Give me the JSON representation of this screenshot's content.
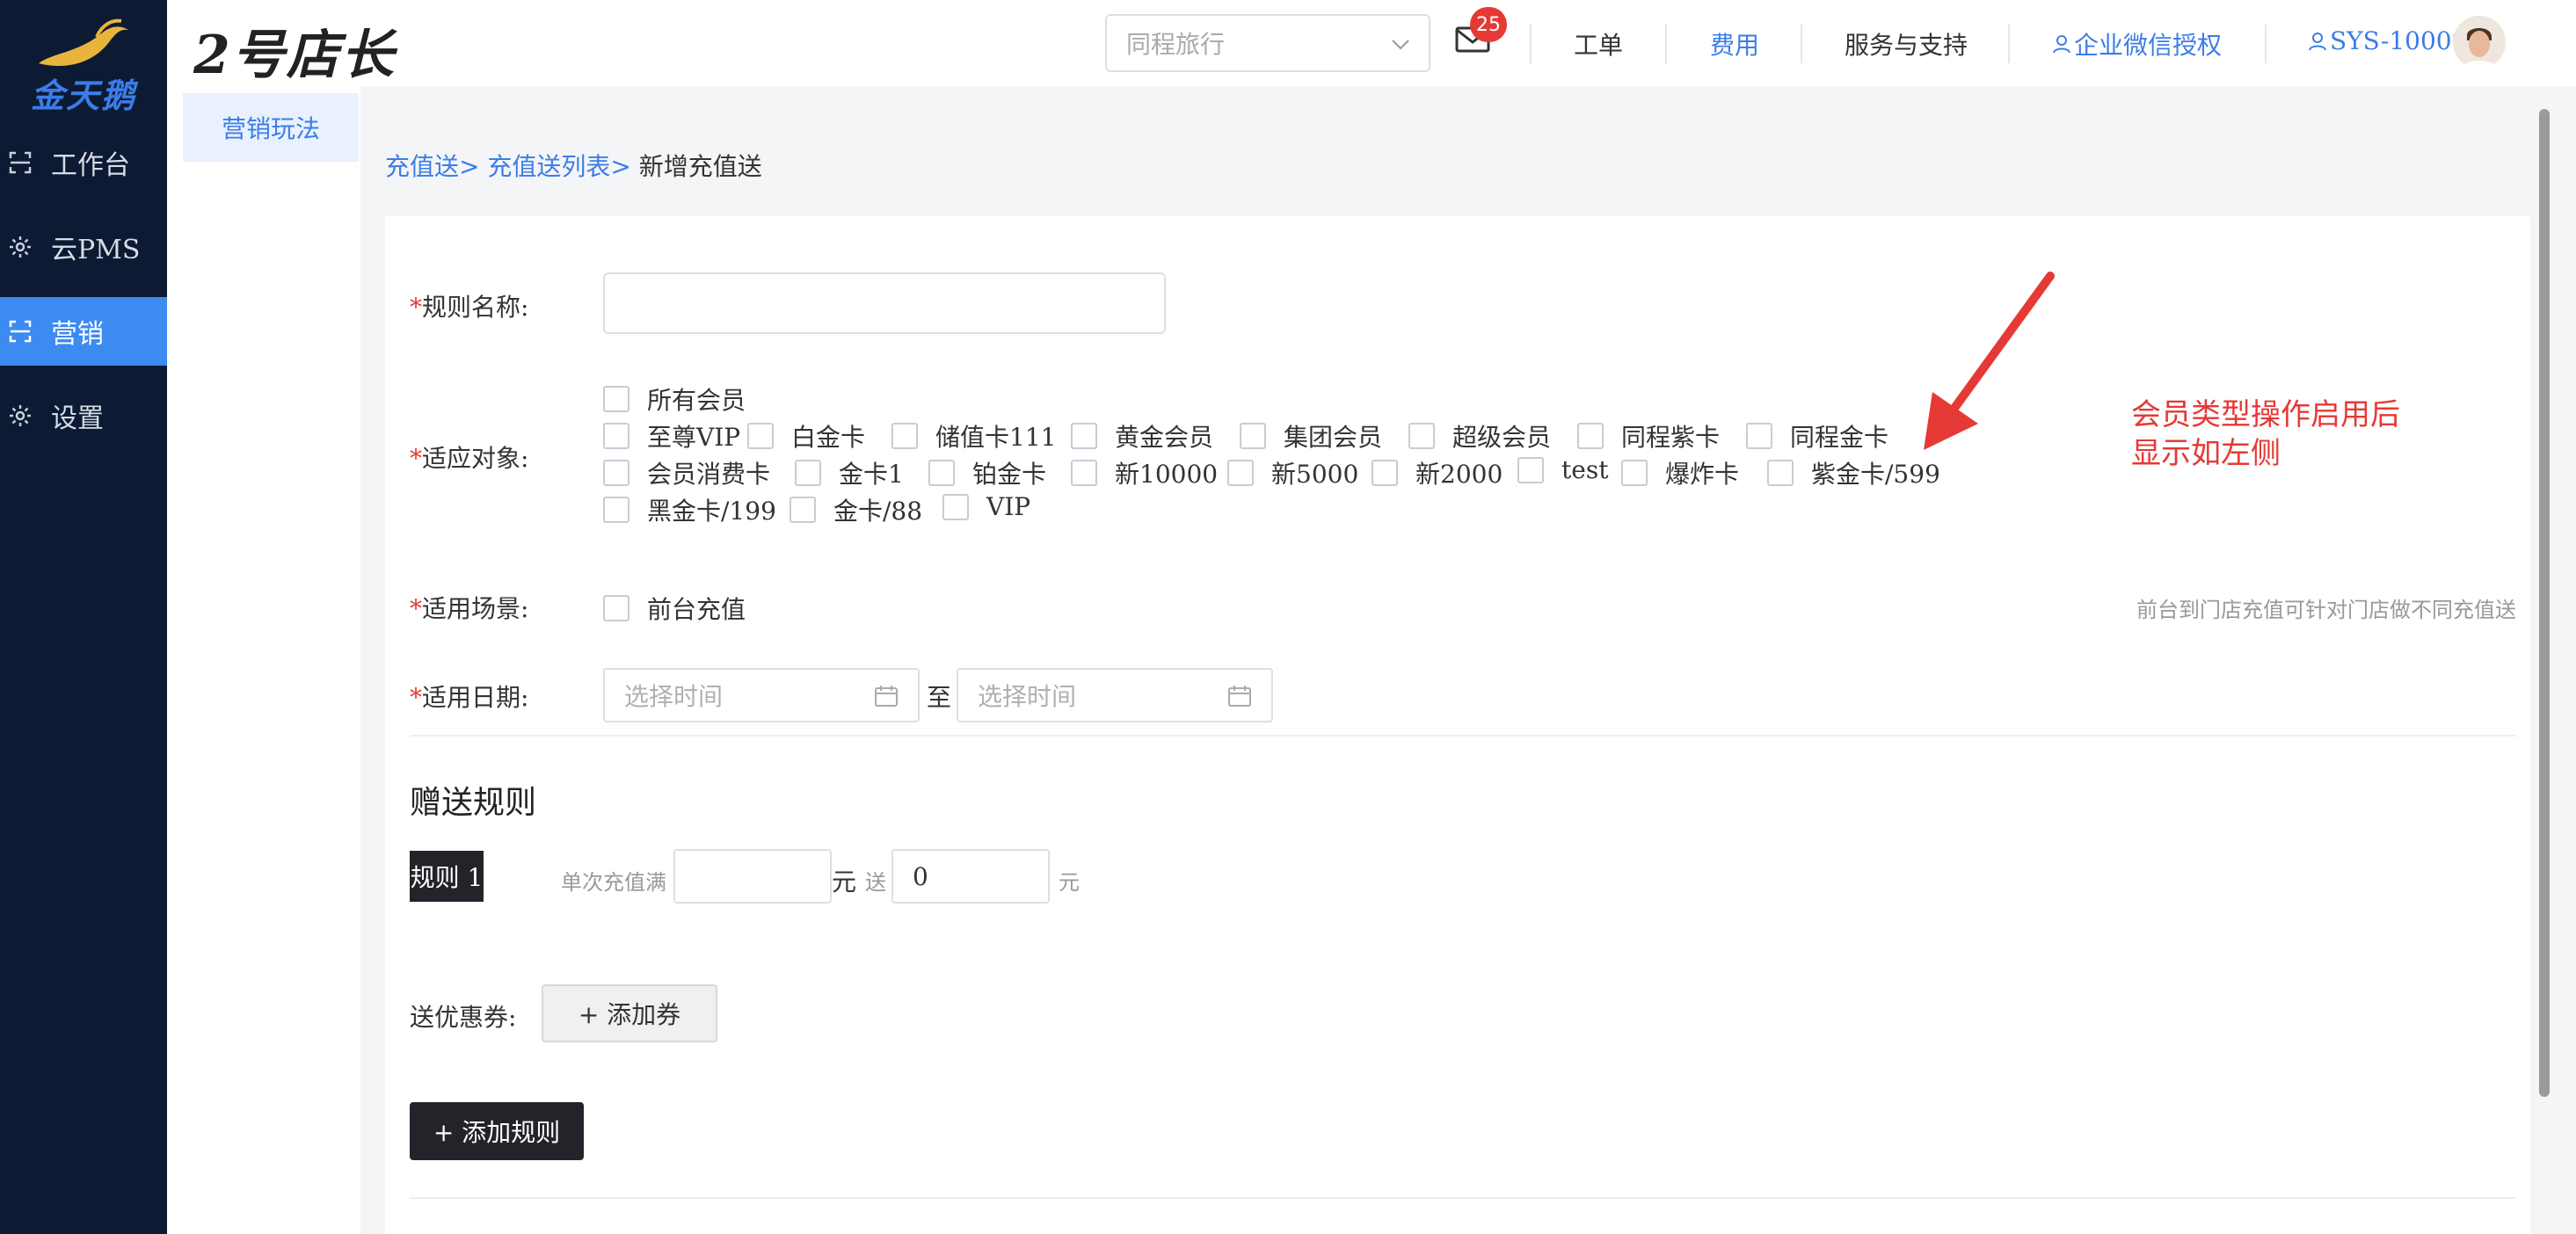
{
  "brand": {
    "name": "金天鹅"
  },
  "app_title": "2号店长",
  "nav": {
    "items": [
      {
        "label": "工作台",
        "icon": "scan-icon",
        "active": false
      },
      {
        "label": "云PMS",
        "icon": "gear-icon",
        "active": false
      },
      {
        "label": "营销",
        "icon": "scan-icon",
        "active": true
      },
      {
        "label": "设置",
        "icon": "gear-icon",
        "active": false
      }
    ]
  },
  "subnav": {
    "items": [
      {
        "label": "营销玩法",
        "active": true
      }
    ]
  },
  "header": {
    "hotel_select": "同程旅行",
    "mail_badge": "25",
    "links": {
      "ticket": "工单",
      "fees": "费用",
      "service": "服务与支持",
      "wechat_auth": "企业微信授权",
      "account": "SYS-10009"
    }
  },
  "breadcrumb": {
    "crumb1": "充值送>",
    "crumb2": "充值送列表>",
    "current": "新增充值送"
  },
  "form": {
    "rule_name_label": "规则名称:",
    "target_label": "适应对象:",
    "target_all": "所有会员",
    "member_types": [
      "至尊VIP",
      "白金卡",
      "储值卡111",
      "黄金会员",
      "集团会员",
      "超级会员",
      "同程紫卡",
      "同程金卡",
      "会员消费卡",
      "金卡1",
      "铂金卡",
      "新10000",
      "新5000",
      "新2000",
      "test",
      "爆炸卡",
      "紫金卡/599",
      "黑金卡/199",
      "金卡/88",
      "VIP"
    ],
    "scene_label": "适用场景:",
    "scene_option": "前台充值",
    "scene_hint": "前台到门店充值可针对门店做不同充值送",
    "date_label": "适用日期:",
    "date_start_placeholder": "选择时间",
    "date_sep": "至",
    "date_end_placeholder": "选择时间"
  },
  "gift": {
    "section_title": "赠送规则",
    "rule_tag": "规则 1",
    "recharge_label": "单次充值满",
    "recharge_value": "",
    "unit1": "元",
    "send_label": "送",
    "send_value": "0",
    "unit2": "元",
    "coupon_label": "送优惠券:",
    "add_coupon": "+ 添加券",
    "add_rule": "+ 添加规则"
  },
  "annotation": {
    "line1": "会员类型操作启用后",
    "line2": "显示如左侧"
  },
  "colors": {
    "nav_bg": "#0d1a33",
    "accent": "#3c8bf0",
    "link": "#3b7de8",
    "required": "#e53935",
    "dark_button": "#23242a"
  }
}
